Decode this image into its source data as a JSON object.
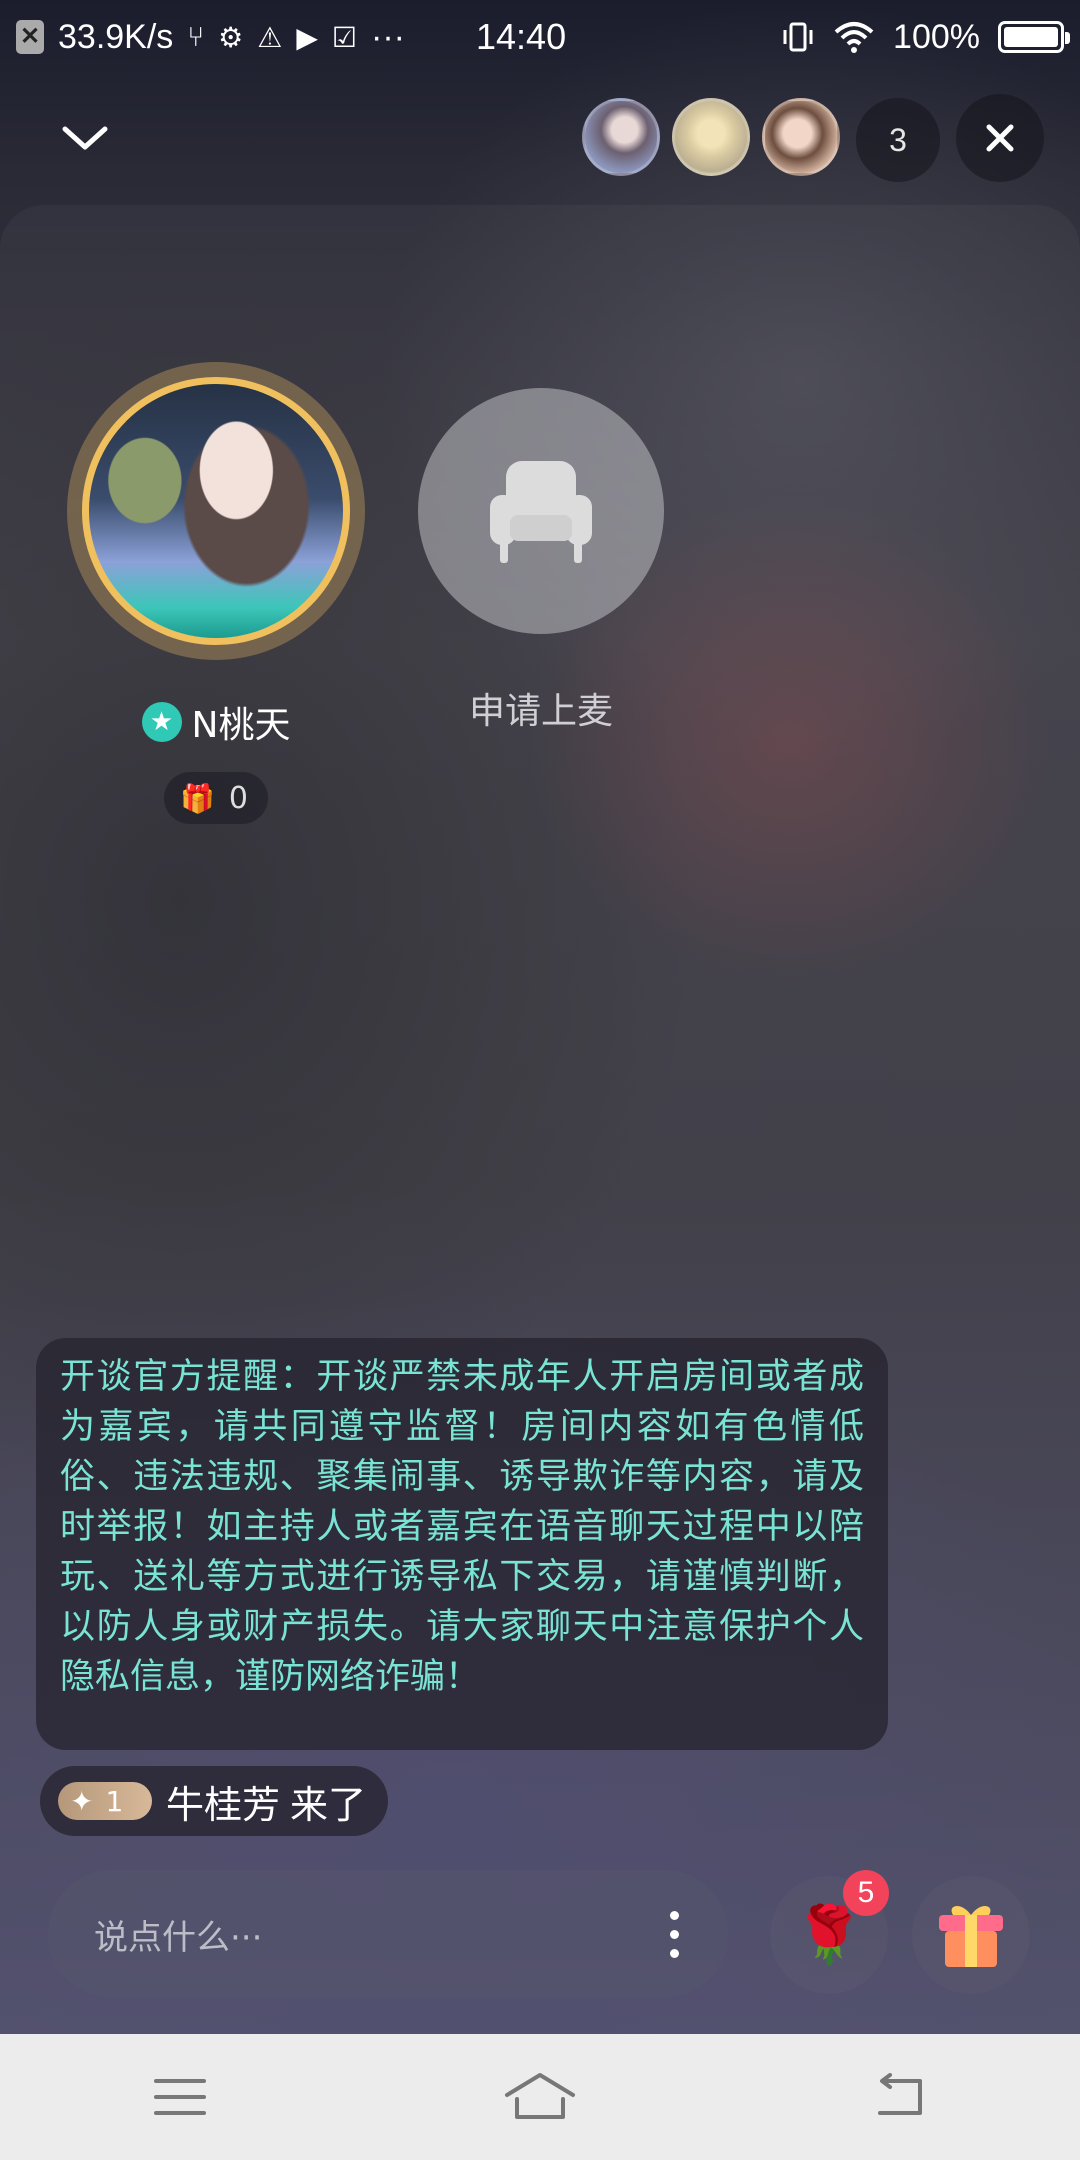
{
  "status_bar": {
    "net_speed": "33.9K/s",
    "time": "14:40",
    "battery": "100%",
    "more": "···"
  },
  "header": {
    "viewer_count": "3",
    "viewer_avatars": [
      "viewer-1",
      "viewer-2",
      "viewer-3"
    ]
  },
  "host": {
    "name": "N桃天",
    "gift_count": "0"
  },
  "empty_seat": {
    "label": "申请上麦"
  },
  "notice": {
    "text": "开谈官方提醒：开谈严禁未成年人开启房间或者成为嘉宾，请共同遵守监督！房间内容如有色情低俗、违法违规、聚集闹事、诱导欺诈等内容，请及时举报！如主持人或者嘉宾在语音聊天过程中以陪玩、送礼等方式进行诱导私下交易，请谨慎判断，以防人身或财产损失。请大家聊天中注意保护个人隐私信息，谨防网络诈骗！"
  },
  "join_message": {
    "level": "1",
    "user": "牛桂芳",
    "action": "来了"
  },
  "input": {
    "placeholder": "说点什么···"
  },
  "rose": {
    "badge": "5",
    "icon": "rose-icon"
  },
  "colors": {
    "notice_text": "#79e3d4",
    "host_ring": "#f0c05e",
    "badge": "#f2435a",
    "star_badge": "#2fc9b6"
  }
}
